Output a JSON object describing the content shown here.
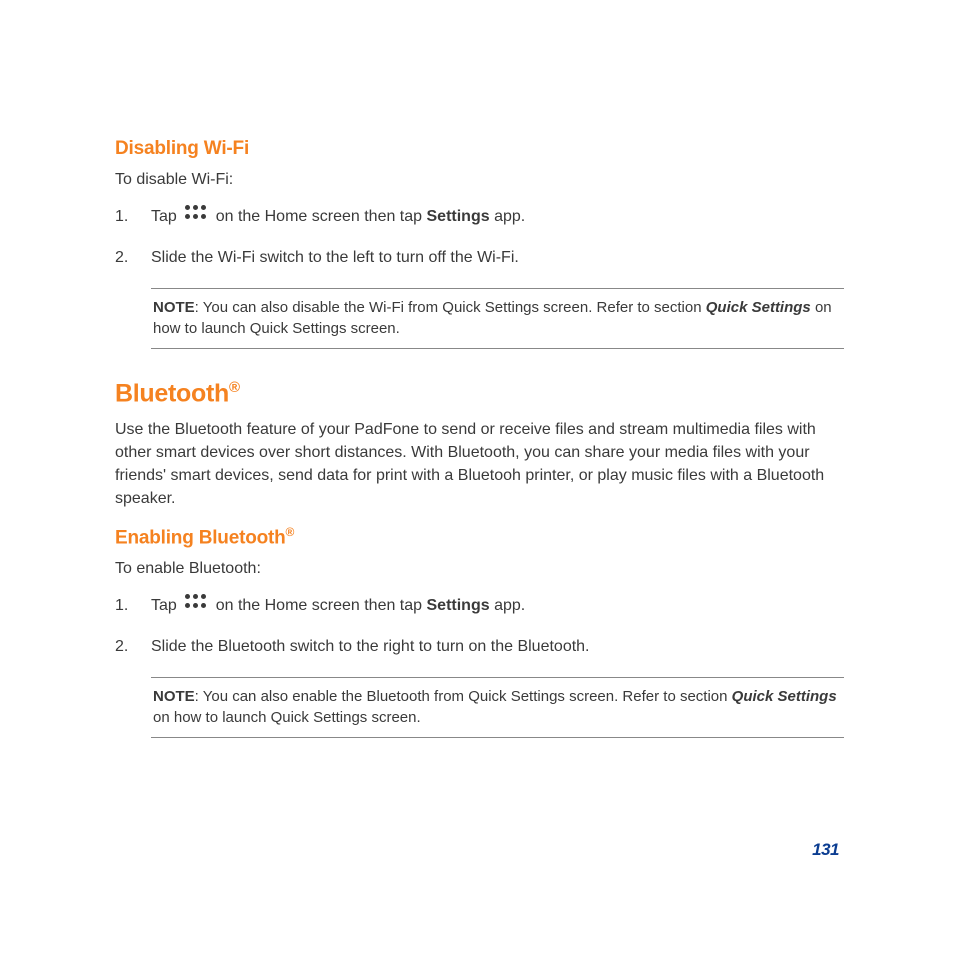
{
  "page_number": "131",
  "sections": {
    "wifi": {
      "heading": "Disabling Wi-Fi",
      "intro": "To disable Wi-Fi:",
      "steps": {
        "s1_a": "Tap ",
        "s1_b": " on the Home screen then tap ",
        "s1_bold": "Settings",
        "s1_c": " app.",
        "s2": "Slide the Wi-Fi switch to the left to turn off the Wi-Fi."
      },
      "note": {
        "label": "NOTE",
        "a": ":  You can also disable the Wi-Fi from Quick Settings screen. Refer to section ",
        "em": "Quick Settings",
        "b": " on how to launch Quick Settings screen."
      }
    },
    "bluetooth": {
      "heading": "Bluetooth",
      "heading_sup": "®",
      "intro": "Use the Bluetooth feature of your PadFone to send or receive files and stream multimedia files with other smart devices over short distances. With Bluetooth, you can share your media files with your friends' smart devices, send data for print with a Bluetooh printer, or play music files with a Bluetooth speaker.",
      "enable": {
        "heading": "Enabling Bluetooth",
        "heading_sup": "®",
        "intro": "To enable Bluetooth:",
        "steps": {
          "s1_a": "Tap ",
          "s1_b": " on the Home screen then tap ",
          "s1_bold": "Settings",
          "s1_c": " app.",
          "s2": "Slide the Bluetooth switch to the right to turn on the Bluetooth."
        },
        "note": {
          "label": "NOTE",
          "a": ":  You can also enable the Bluetooth from Quick Settings screen. Refer to section ",
          "em": "Quick Settings",
          "b": " on how to launch Quick Settings screen."
        }
      }
    }
  }
}
